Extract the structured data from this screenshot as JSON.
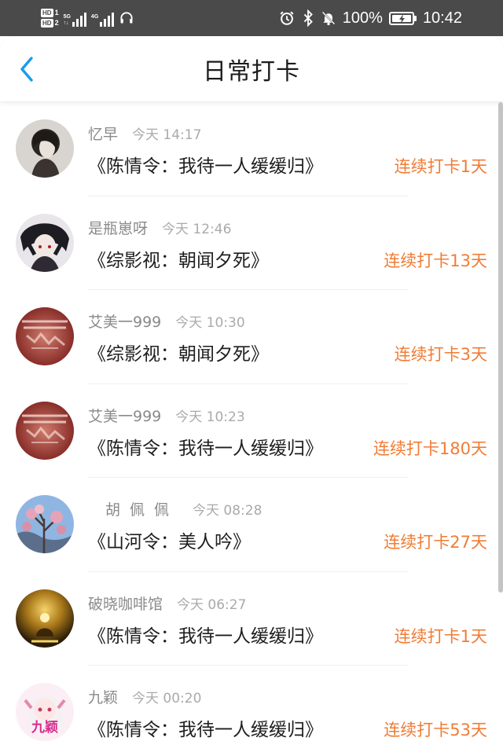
{
  "status_bar": {
    "sim1": "HD",
    "sim1_num": "1",
    "sim2": "HD",
    "sim2_num": "2",
    "net1": "5G",
    "net2": "4G",
    "battery": "100%",
    "time": "10:42",
    "icons": [
      "headphone-icon",
      "alarm-icon",
      "bluetooth-icon",
      "mute-icon",
      "battery-charging-icon"
    ]
  },
  "header": {
    "title": "日常打卡",
    "back_icon": "chevron-left-icon",
    "accent": "#1a9bef"
  },
  "colors": {
    "streak": "#f07c36",
    "name": "#8a8a8a",
    "time": "#aaaaaa"
  },
  "checkins": [
    {
      "name": "忆早",
      "time": "今天 14:17",
      "book": "《陈情令：我待一人缓缓归》",
      "streak": "连续打卡1天"
    },
    {
      "name": "是瓶崽呀",
      "time": "今天 12:46",
      "book": "《综影视：朝闻夕死》",
      "streak": "连续打卡13天"
    },
    {
      "name": "艾美一999",
      "time": "今天 10:30",
      "book": "《综影视：朝闻夕死》",
      "streak": "连续打卡3天"
    },
    {
      "name": "艾美一999",
      "time": "今天 10:23",
      "book": "《陈情令：我待一人缓缓归》",
      "streak": "连续打卡180天"
    },
    {
      "name": "胡佩佩",
      "time": "今天 08:28",
      "book": "《山河令：美人吟》",
      "streak": "连续打卡27天"
    },
    {
      "name": "破晓咖啡馆",
      "time": "今天 06:27",
      "book": "《陈情令：我待一人缓缓归》",
      "streak": "连续打卡1天"
    },
    {
      "name": "九颖",
      "time": "今天 00:20",
      "book": "《陈情令：我待一人缓缓归》",
      "streak": "连续打卡53天",
      "avatar_text": "九颖"
    }
  ]
}
